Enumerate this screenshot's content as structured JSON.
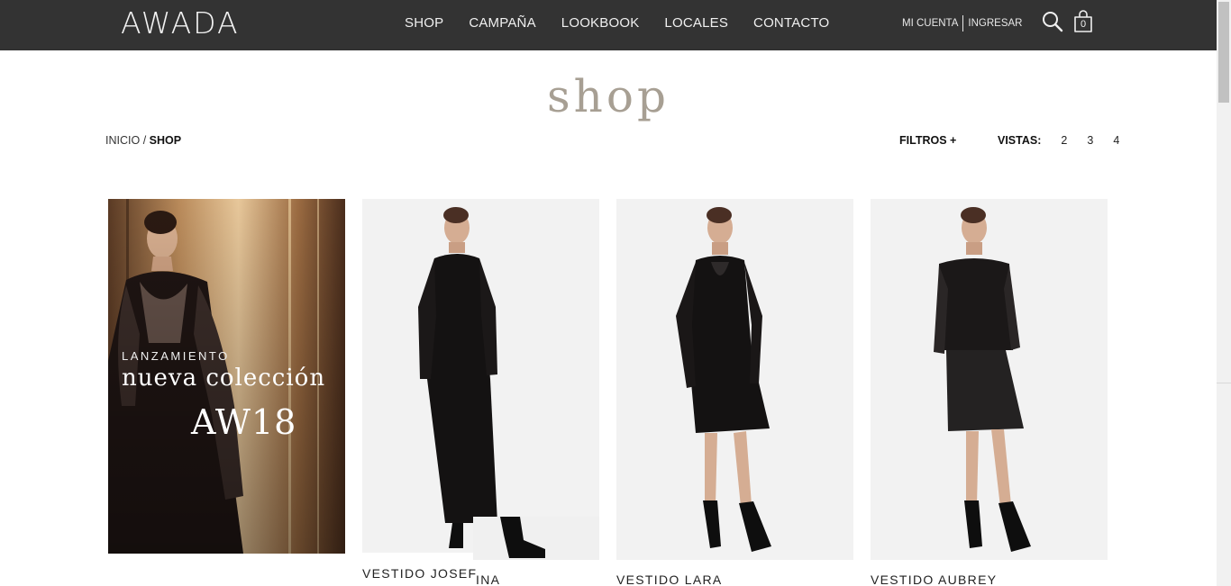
{
  "header": {
    "logo": "AWADA",
    "nav": [
      "SHOP",
      "CAMPAÑA",
      "LOOKBOOK",
      "LOCALES",
      "CONTACTO"
    ],
    "account": "MI CUENTA",
    "login": "INGRESAR",
    "cart_count": "0",
    "search_icon": "search-icon",
    "cart_icon": "shopping-bag-icon"
  },
  "page": {
    "title": "shop",
    "breadcrumb": {
      "home": "INICIO",
      "separator": "/",
      "current": "SHOP"
    },
    "filters": "FILTROS +",
    "views_label": "VISTAS:",
    "views": [
      "2",
      "3",
      "4"
    ]
  },
  "promo": {
    "eyebrow": "LANZAMIENTO",
    "title": "nueva colección",
    "season": "AW18"
  },
  "products": [
    {
      "name_part1": "VESTIDO JOSEF",
      "name_part2": "INA"
    },
    {
      "name": "VESTIDO LARA"
    },
    {
      "name": "VESTIDO AUBREY"
    }
  ],
  "colors": {
    "header_bg": "#333333",
    "title_accent": "#a79f93"
  }
}
